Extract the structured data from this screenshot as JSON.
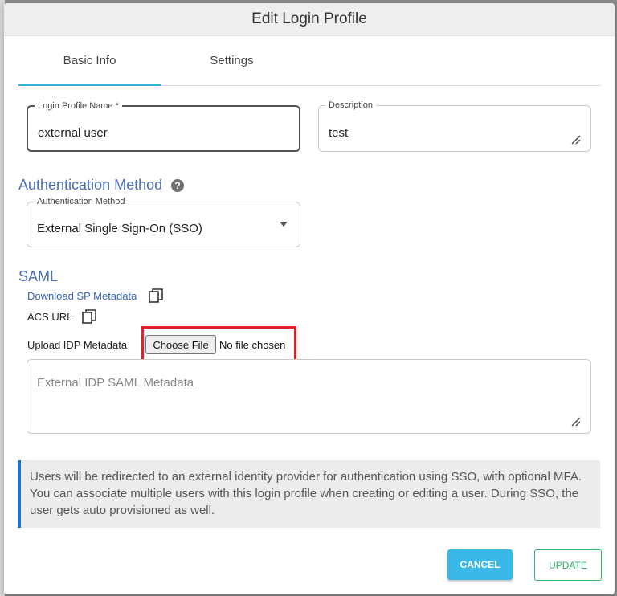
{
  "dialog": {
    "title": "Edit Login Profile"
  },
  "tabs": [
    {
      "label": "Basic Info",
      "active": true
    },
    {
      "label": "Settings",
      "active": false
    }
  ],
  "login_profile_name": {
    "label": "Login Profile Name *",
    "value": "external user"
  },
  "description": {
    "label": "Description",
    "value": "test"
  },
  "auth_section": {
    "title": "Authentication Method",
    "help_icon": "question-circle-icon",
    "select_label": "Authentication Method",
    "selected": "External Single Sign-On (SSO)"
  },
  "saml": {
    "title": "SAML",
    "download_sp_metadata": "Download SP Metadata",
    "acs_url": "ACS URL",
    "upload_idp_label": "Upload IDP Metadata",
    "choose_file": "Choose File",
    "file_status": "No file chosen",
    "idp_metadata_placeholder": "External IDP SAML Metadata",
    "copy_icon": "copy-icon"
  },
  "info": {
    "text": "Users will be redirected to an external identity provider for authentication using SSO, with optional MFA. You can associate multiple users with this login profile when creating or editing a user. During SSO, the user gets auto provisioned as well."
  },
  "actions": {
    "cancel": "CANCEL",
    "update": "UPDATE"
  },
  "colors": {
    "accent": "#3aaee0",
    "section_title": "#4a6db5",
    "highlight": "#e0202a",
    "cancel_bg": "#3ab8e8",
    "update": "#2fb56a",
    "info_border": "#1e73c8"
  }
}
